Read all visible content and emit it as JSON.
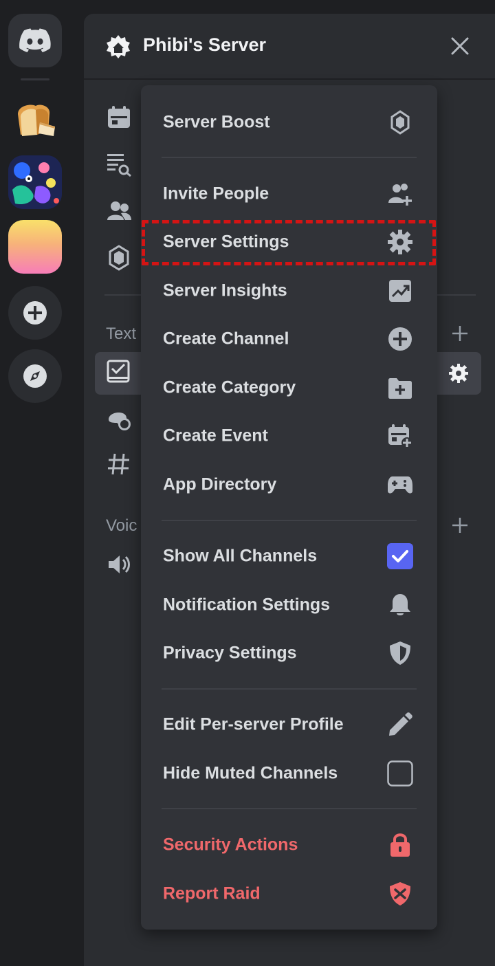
{
  "server": {
    "name": "Phibi's Server"
  },
  "channels": {
    "text_section_label": "Text",
    "voice_section_label": "Voic"
  },
  "menu": {
    "items": [
      {
        "label": "Server Boost",
        "icon": "boost-icon"
      },
      {
        "label": "Invite People",
        "icon": "invite-people-icon"
      },
      {
        "label": "Server Settings",
        "icon": "gear-icon"
      },
      {
        "label": "Server Insights",
        "icon": "insights-icon"
      },
      {
        "label": "Create Channel",
        "icon": "plus-circle-icon"
      },
      {
        "label": "Create Category",
        "icon": "folder-plus-icon"
      },
      {
        "label": "Create Event",
        "icon": "calendar-plus-icon"
      },
      {
        "label": "App Directory",
        "icon": "gamepad-icon"
      },
      {
        "label": "Show All Channels",
        "icon": "checkbox-checked-icon",
        "checked": true
      },
      {
        "label": "Notification Settings",
        "icon": "bell-icon"
      },
      {
        "label": "Privacy Settings",
        "icon": "shield-icon"
      },
      {
        "label": "Edit Per-server Profile",
        "icon": "pencil-icon"
      },
      {
        "label": "Hide Muted Channels",
        "icon": "checkbox-empty-icon",
        "checked": false
      },
      {
        "label": "Security Actions",
        "icon": "lock-icon"
      },
      {
        "label": "Report Raid",
        "icon": "shield-alert-icon"
      }
    ]
  },
  "colors": {
    "accent": "#5865f2",
    "danger": "#f0686b",
    "highlight": "#d41414"
  }
}
